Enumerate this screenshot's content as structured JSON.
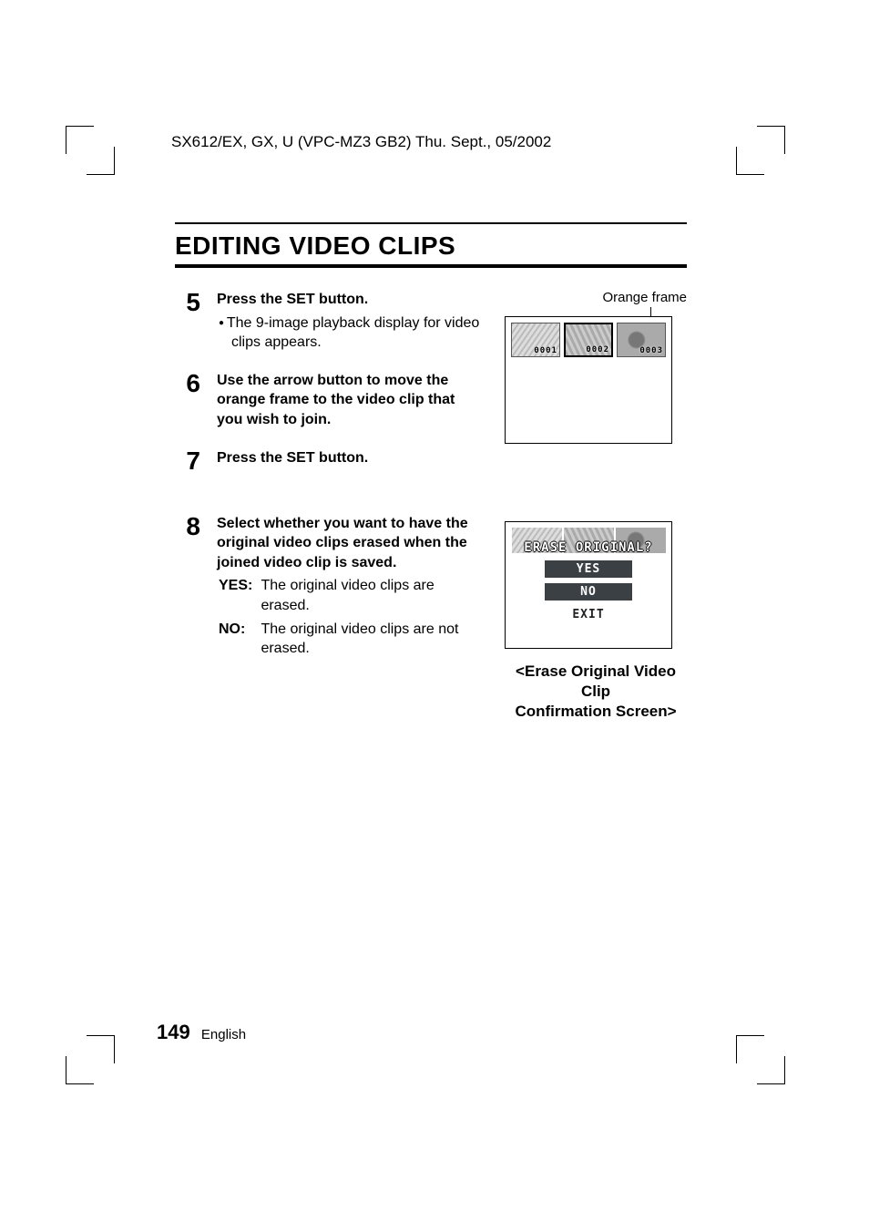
{
  "header": "SX612/EX, GX, U (VPC-MZ3 GB2)    Thu. Sept., 05/2002",
  "title": "EDITING VIDEO CLIPS",
  "steps": {
    "s5": {
      "num": "5",
      "head": "Press the SET button.",
      "bullet": "The 9-image playback display for video clips appears."
    },
    "s6": {
      "num": "6",
      "head": "Use the arrow button to move the orange frame to the video clip that you wish to join."
    },
    "s7": {
      "num": "7",
      "head": "Press the SET button."
    },
    "s8": {
      "num": "8",
      "head": "Select whether you want to have the original video clips erased when the joined video clip is saved.",
      "yes_label": "YES:",
      "yes_text": "The original video clips are erased.",
      "no_label": "NO:",
      "no_text": "The original video clips are not erased."
    }
  },
  "fig1": {
    "label": "Orange frame",
    "thumbs": [
      "0001",
      "0002",
      "0003"
    ]
  },
  "fig2": {
    "overlay_title": "ERASE ORIGINAL?",
    "options": {
      "yes": "YES",
      "no": "NO",
      "exit": "EXIT"
    },
    "caption_line1": "<Erase Original Video Clip",
    "caption_line2": "Confirmation Screen>"
  },
  "footer": {
    "page": "149",
    "lang": "English"
  }
}
